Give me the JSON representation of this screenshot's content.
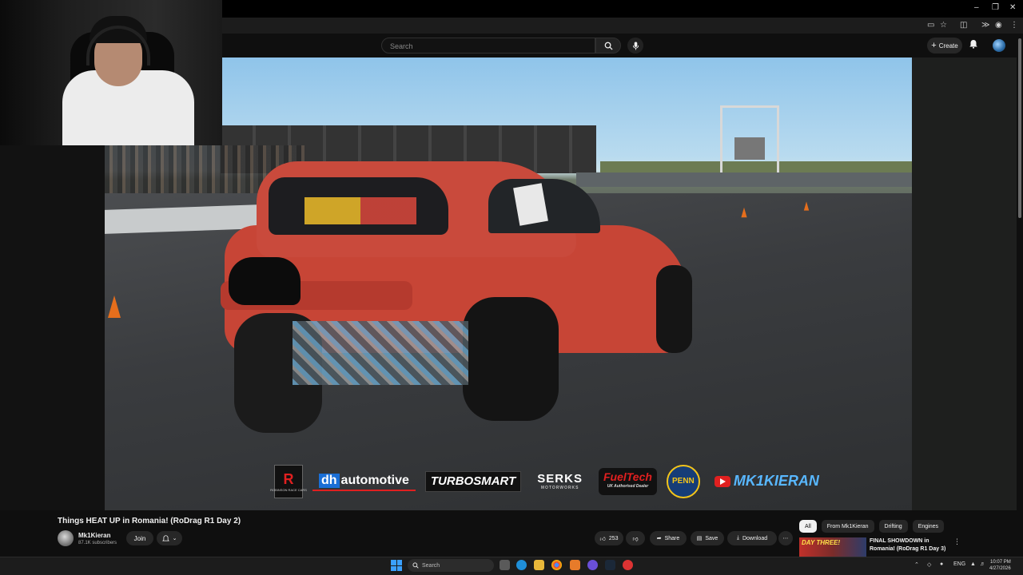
{
  "header": {
    "search_placeholder": "Search",
    "create_label": "Create"
  },
  "video": {
    "title": "Things HEAT UP in Romania! (RoDrag R1 Day 2)",
    "sponsors": {
      "robinson": "R",
      "robinson_sub": "ROBINSON RACE CARS",
      "dh": "dh",
      "dh_rest": "automotive",
      "turbosmart": "TURBOSMART",
      "serks": "SERKS",
      "serks_sub": "MOTORWORKS",
      "fueltech": "FuelTech",
      "fueltech_sub": "UK Authorised Dealer",
      "penn": "PENN",
      "mk1kieran": "MK1KIERAN"
    }
  },
  "channel": {
    "name": "Mk1Kieran",
    "subscribers": "87.1K subscribers",
    "join_label": "Join"
  },
  "actions": {
    "likes": "253",
    "share": "Share",
    "save": "Save",
    "download": "Download"
  },
  "chips": [
    "All",
    "From Mk1Kieran",
    "Drifting",
    "Engines"
  ],
  "recommended": {
    "thumb_text": "DAY THREE!",
    "title": "FINAL SHOWDOWN in Romania! (RoDrag R1 Day 3)"
  },
  "taskbar": {
    "search_label": "Search",
    "language": "ENG",
    "time": "10:07 PM",
    "date": "4/27/2026"
  },
  "colors": {
    "background": "#0f0f0f",
    "pill": "#272727",
    "accent_red": "#e02020"
  }
}
